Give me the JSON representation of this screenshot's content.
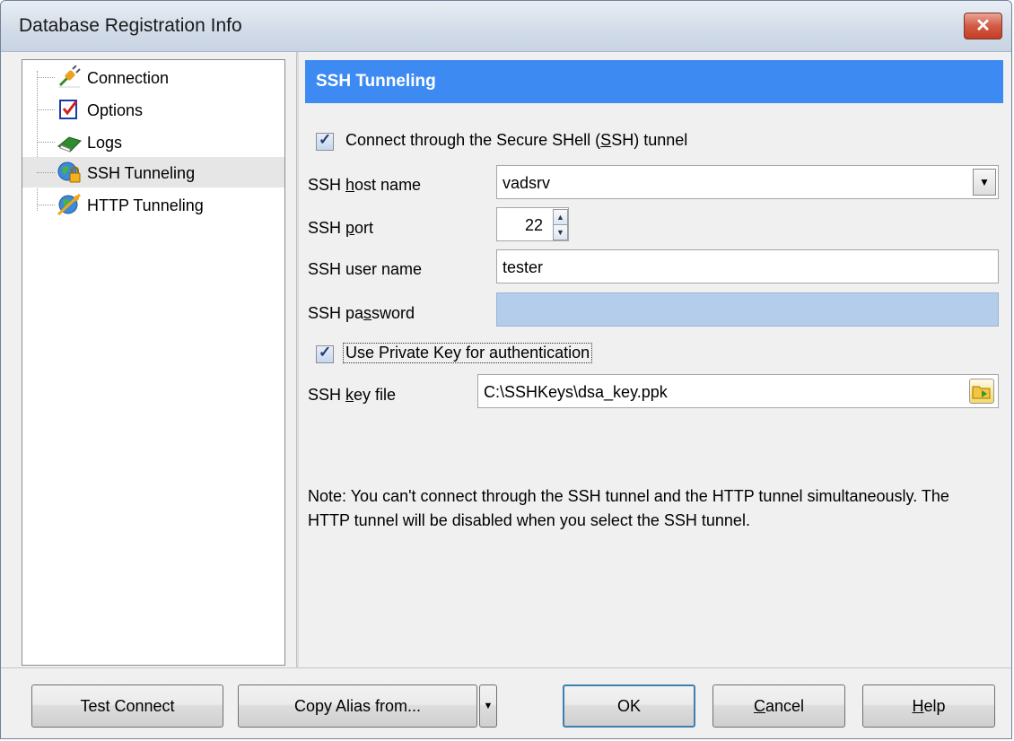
{
  "window": {
    "title": "Database Registration Info",
    "close_glyph": "✕"
  },
  "tree": {
    "items": [
      {
        "label": "Connection",
        "icon": "plug-icon"
      },
      {
        "label": "Options",
        "icon": "options-checkbox-icon"
      },
      {
        "label": "Logs",
        "icon": "book-icon"
      },
      {
        "label": "SSH Tunneling",
        "icon": "globe-lock-icon",
        "selected": true
      },
      {
        "label": "HTTP Tunneling",
        "icon": "globe-satellite-icon"
      }
    ]
  },
  "panel": {
    "header": "SSH Tunneling",
    "ssh_checkbox": {
      "pre": "Connect through the Secure SHell (",
      "key": "S",
      "post": "SH) tunnel",
      "checked": true
    },
    "host": {
      "pre": "SSH ",
      "key": "h",
      "post": "ost name",
      "value": "vadsrv"
    },
    "port": {
      "pre": "SSH ",
      "key": "p",
      "post": "ort",
      "value": "22"
    },
    "user": {
      "label": "SSH user name",
      "value": "tester"
    },
    "password": {
      "pre": "SSH pa",
      "key": "s",
      "post": "sword",
      "value": ""
    },
    "private_key_checkbox": {
      "label": "Use Private Key for authentication",
      "checked": true
    },
    "key_file": {
      "pre": "SSH ",
      "key": "k",
      "post": "ey file",
      "value": "C:\\SSHKeys\\dsa_key.ppk"
    },
    "note": "Note: You can't connect through the SSH tunnel and the HTTP tunnel simultaneously. The HTTP tunnel will be disabled  when you select the SSH tunnel."
  },
  "buttons": {
    "test_connect": "Test Connect",
    "copy_alias": "Copy Alias from...",
    "ok": "OK",
    "cancel": {
      "key": "C",
      "rest": "ancel"
    },
    "help": {
      "key": "H",
      "rest": "elp"
    }
  },
  "colors": {
    "header_bg": "#3d8bf2",
    "password_bg": "#b4cdea",
    "close_btn": "#c53d26"
  }
}
